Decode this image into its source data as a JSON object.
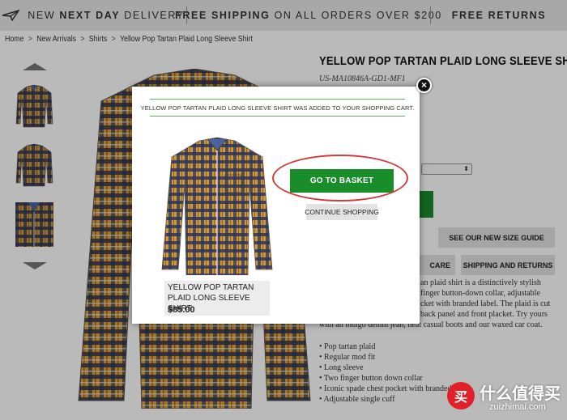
{
  "promo_bar": {
    "seg1_pre": "NEW ",
    "seg1_bold": "NEXT DAY",
    "seg1_post": " DELIVERY",
    "seg2_bold": "FREE SHIPPING",
    "seg2_post": " ON ALL ORDERS OVER $200",
    "seg3_bold": "FREE RETURNS",
    "icon": "paper-plane-icon"
  },
  "breadcrumb": [
    "Home",
    "New Arrivals",
    "Shirts",
    "Yellow Pop Tartan Plaid Long Sleeve Shirt"
  ],
  "product": {
    "title": "YELLOW POP TARTAN PLAID LONG SLEEVE SHIRT",
    "sku": "US-MA10846A-GD1-MF1",
    "size_guide_label": "SEE OUR NEW SIZE GUIDE",
    "care_label": "CARE",
    "shipping_label": "SHIPPING AND RETURNS",
    "description": [
      "an plaid shirt is a distinctively stylish",
      "finger button-down collar, adjustable",
      "cket with branded label. The plaid is cut",
      "back panel and front placket. Try yours",
      "with an indigo denim jean, neat casual boots and our waxed car coat."
    ],
    "bullets": [
      "• Pop tartan plaid",
      "• Regular mod fit",
      "• Long sleeve",
      "• Two finger button down collar",
      "• Iconic spade chest pocket with branded",
      "• Adjustable single cuff"
    ]
  },
  "modal": {
    "close_label": "×",
    "added_message": "YELLOW POP TARTAN PLAID LONG SLEEVE SHIRT WAS ADDED TO YOUR SHOPPING CART.",
    "basket_button": "GO TO BASKET",
    "continue_button": "CONTINUE SHOPPING",
    "item_name": "YELLOW POP TARTAN PLAID LONG SLEEVE SHIRT",
    "item_price": "$85.00"
  },
  "watermark": {
    "badge": "买",
    "title": "什么值得买",
    "sub": "zuizhimai.com"
  },
  "colors": {
    "accent_green": "#1a8d2b",
    "highlight_red": "#d43a3a",
    "plaid_yellow": "#d9a43a",
    "plaid_navy": "#2c3556"
  }
}
